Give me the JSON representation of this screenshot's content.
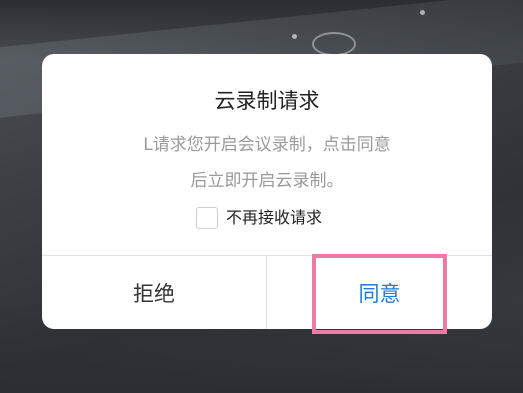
{
  "dialog": {
    "title": "云录制请求",
    "message_line1": "L请求您开启会议录制，点击同意",
    "message_line2": "后立即开启云录制。",
    "checkbox_label": "不再接收请求",
    "checkbox_checked": false,
    "reject_label": "拒绝",
    "accept_label": "同意"
  },
  "colors": {
    "accent": "#1a7be0",
    "highlight": "#ee7aa6"
  }
}
